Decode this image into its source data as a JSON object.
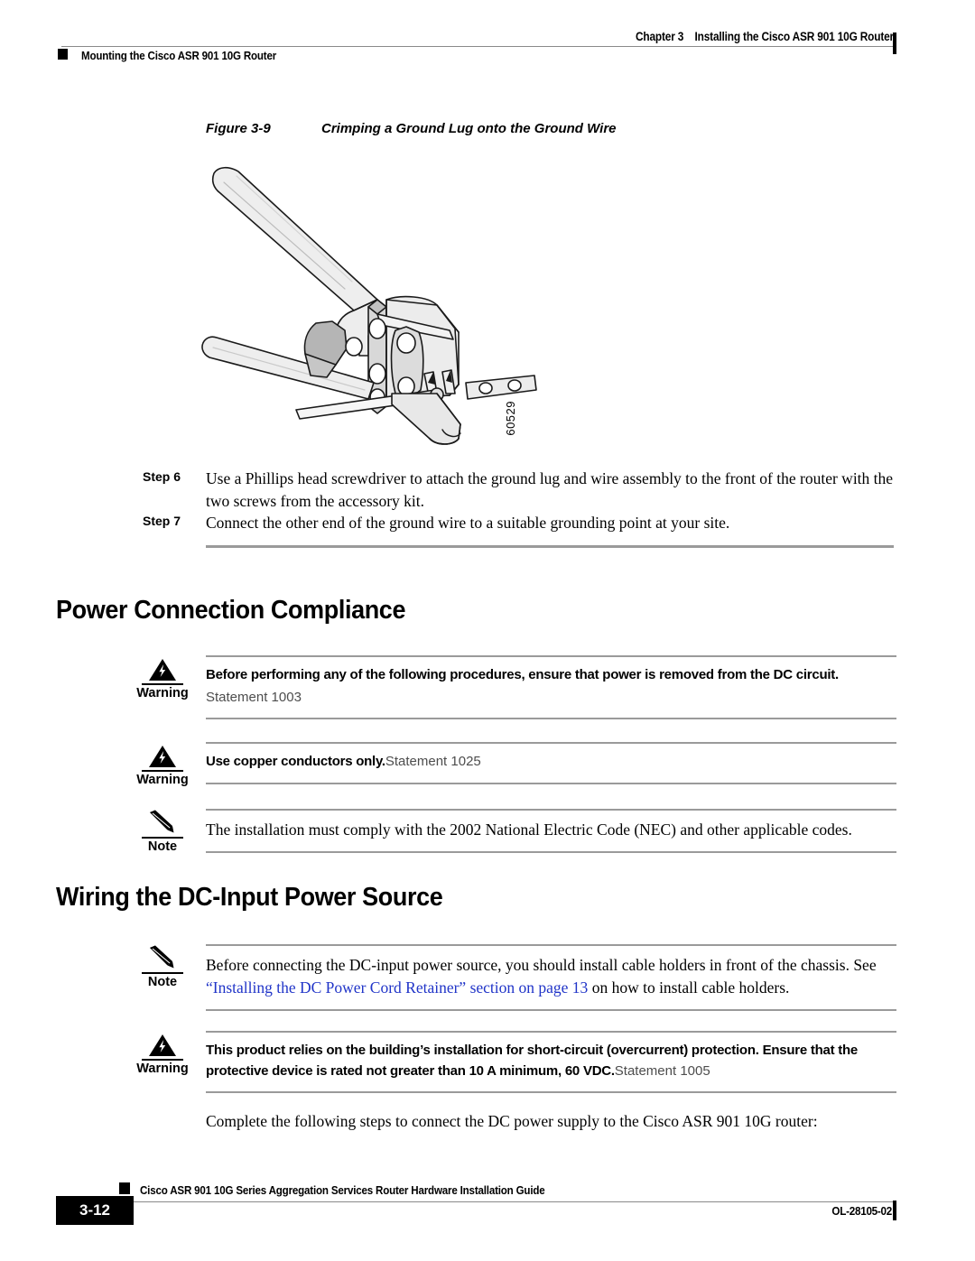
{
  "header": {
    "chapter_label": "Chapter 3",
    "chapter_title": "Installing the Cisco ASR 901 10G Router",
    "section_title": "Mounting the Cisco ASR 901 10G Router"
  },
  "figure": {
    "number": "Figure 3-9",
    "title": "Crimping a Ground Lug onto the Ground Wire",
    "art_id": "60529",
    "alt": "Line drawing of a hand crimping tool crimping a ground lug onto a ground wire"
  },
  "steps": [
    {
      "label": "Step 6",
      "text": "Use a Phillips head screwdriver to attach the ground lug and wire assembly to the front of the router with the two screws from the accessory kit."
    },
    {
      "label": "Step 7",
      "text": "Connect the other end of the ground wire to a suitable grounding point at your site."
    }
  ],
  "sections": [
    {
      "heading": "Power Connection Compliance"
    },
    {
      "heading": "Wiring the DC-Input Power Source"
    }
  ],
  "admonitions": {
    "warn_1003": {
      "label": "Warning",
      "icon": "warning-triangle-icon",
      "text": "Before performing any of the following procedures, ensure that power is removed from the DC circuit.",
      "statement": "Statement 1003"
    },
    "warn_1025": {
      "label": "Warning",
      "icon": "warning-triangle-icon",
      "text": "Use copper conductors only.",
      "statement": "Statement 1025"
    },
    "note_nec": {
      "label": "Note",
      "icon": "note-pencil-icon",
      "text": "The installation must comply with the 2002 National Electric Code (NEC) and other applicable codes."
    },
    "note_cable": {
      "label": "Note",
      "icon": "note-pencil-icon",
      "text_before": "Before connecting the DC-input power source, you should install cable holders in front of the chassis. See ",
      "link_text": "“Installing the DC Power Cord Retainer” section on page 13",
      "text_after": " on how to install cable holders."
    },
    "warn_1005": {
      "label": "Warning",
      "icon": "warning-triangle-icon",
      "text": "This product relies on the building’s installation for short-circuit (overcurrent) protection. Ensure that the protective device is rated not greater than 10 A minimum, 60 VDC.",
      "statement": "Statement 1005"
    }
  },
  "closing_paragraph": "Complete the following steps to connect the DC power supply to the Cisco ASR 901 10G router:",
  "footer": {
    "guide_title": "Cisco ASR 901 10G Series Aggregation Services Router Hardware Installation Guide",
    "page_number": "3-12",
    "doc_id": "OL-28105-02"
  },
  "colors": {
    "link": "#2034c8",
    "rule": "#9a9a9a",
    "statement_gray": "#4d4d4d",
    "text": "#000000"
  }
}
